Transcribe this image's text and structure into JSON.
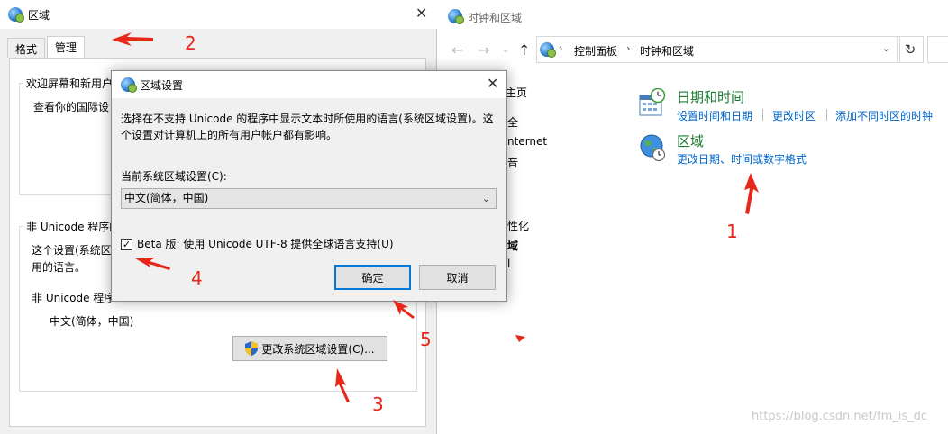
{
  "region_window": {
    "title": "区域",
    "tabs": [
      "格式",
      "管理"
    ],
    "welcome_group": {
      "title": "欢迎屏幕和新用户",
      "text": "查看你的国际设"
    },
    "unicode_group": {
      "title": "非 Unicode 程序的",
      "desc_line1": "这个设置(系统区",
      "desc_line2": "用的语言。",
      "current_label": "非 Unicode 程序",
      "current_value": "中文(简体，中国)",
      "change_button": "更改系统区域设置(C)..."
    }
  },
  "control_panel": {
    "title": "时钟和区域",
    "breadcrumb": [
      "控制面板",
      "时钟和区域"
    ],
    "left_nav": [
      "主页",
      "全",
      "nternet",
      "音",
      "",
      "性化",
      "域",
      "l"
    ],
    "datetime": {
      "title": "日期和时间",
      "links": [
        "设置时间和日期",
        "更改时区",
        "添加不同时区的时钟"
      ]
    },
    "region": {
      "title": "区域",
      "link": "更改日期、时间或数字格式"
    },
    "watermark": "https://blog.csdn.net/fm_is_dc"
  },
  "dialog": {
    "title": "区域设置",
    "desc_line1": "选择在不支持 Unicode 的程序中显示文本时所使用的语言(系统区域设置)。这",
    "desc_line2": "个设置对计算机上的所有用户帐户都有影响。",
    "current_label": "当前系统区域设置(C):",
    "current_value": "中文(简体，中国)",
    "beta_label": "Beta 版: 使用 Unicode UTF-8 提供全球语言支持(U)",
    "beta_checked": true,
    "ok": "确定",
    "cancel": "取消"
  },
  "annotations": [
    "1",
    "2",
    "3",
    "4",
    "5"
  ],
  "colors": {
    "annotation": "#e8271b",
    "link": "#0066cc",
    "category": "#1e7b34",
    "focus": "#0078d7"
  }
}
